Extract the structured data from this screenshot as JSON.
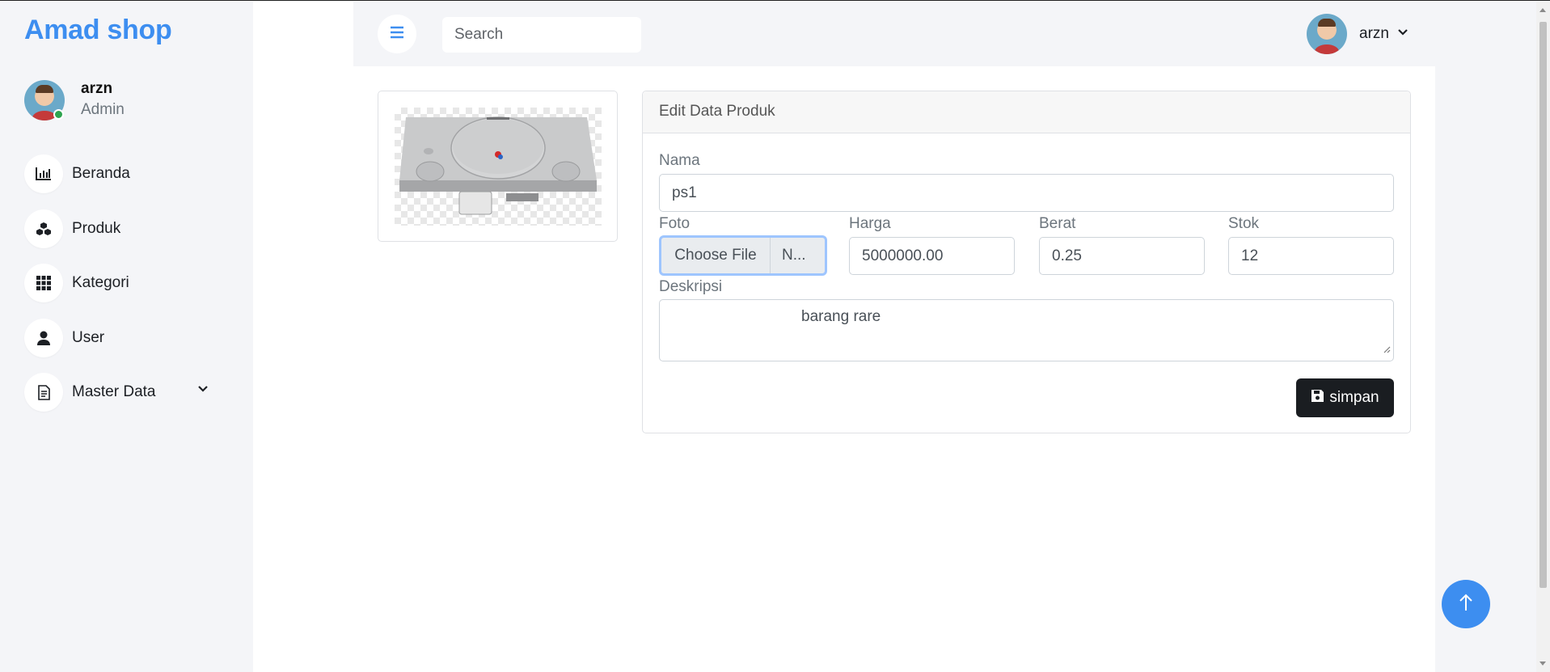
{
  "brand": {
    "name": "Amad shop",
    "color": "#3d8ef0"
  },
  "sidebar": {
    "user": {
      "name": "arzn",
      "role": "Admin",
      "status": "online"
    },
    "items": [
      {
        "label": "Beranda",
        "icon": "bar-chart-icon"
      },
      {
        "label": "Produk",
        "icon": "boxes-icon"
      },
      {
        "label": "Kategori",
        "icon": "grid-icon"
      },
      {
        "label": "User",
        "icon": "person-icon"
      },
      {
        "label": "Master Data",
        "icon": "document-icon",
        "has_submenu": true
      }
    ]
  },
  "topbar": {
    "search": {
      "placeholder": "Search",
      "value": ""
    },
    "user": {
      "name": "arzn"
    }
  },
  "product_image": {
    "alt": "ps1"
  },
  "form": {
    "title": "Edit Data Produk",
    "fields": {
      "nama": {
        "label": "Nama",
        "value": "ps1"
      },
      "foto": {
        "label": "Foto",
        "button": "Choose File",
        "file_name": "N..."
      },
      "harga": {
        "label": "Harga",
        "value": "5000000.00"
      },
      "berat": {
        "label": "Berat",
        "value": "0.25"
      },
      "stok": {
        "label": "Stok",
        "value": "12"
      },
      "deskripsi": {
        "label": "Deskripsi",
        "value": "barang rare"
      }
    },
    "save_label": "simpan"
  },
  "colors": {
    "accent": "#3d8ef0",
    "dark_button": "#1a1d21",
    "status_online": "#2ea44f"
  }
}
